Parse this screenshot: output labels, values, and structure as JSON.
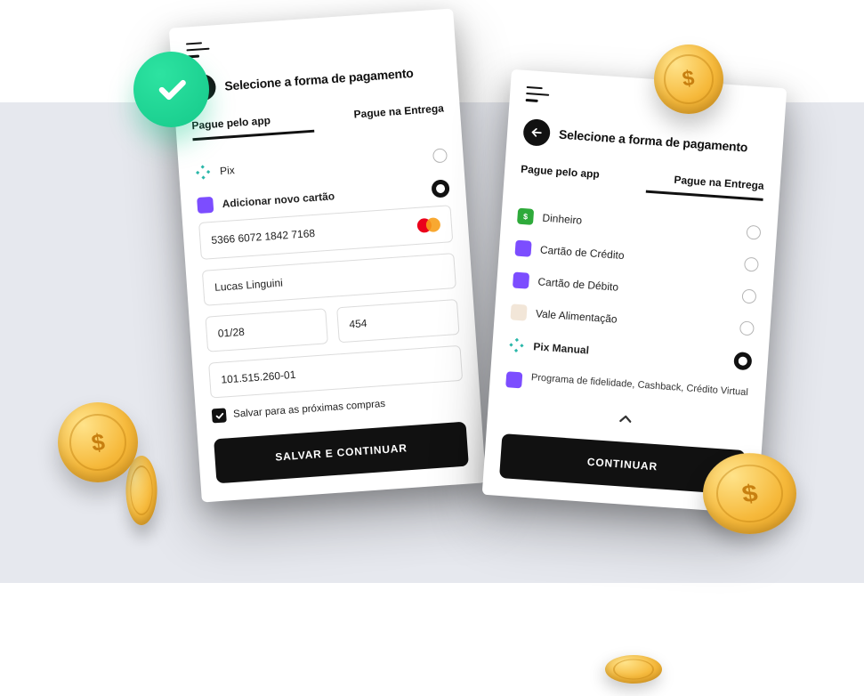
{
  "left": {
    "title": "Selecione a forma de pagamento",
    "tab_app": "Pague pelo app",
    "tab_delivery": "Pague na Entrega",
    "active_tab": "app",
    "options": {
      "pix": {
        "label": "Pix",
        "selected": false
      },
      "new_card": {
        "label": "Adicionar novo cartão",
        "selected": true
      }
    },
    "card_form": {
      "number": "5366 6072 1842 7168",
      "brand": "mastercard",
      "name": "Lucas Linguini",
      "expiry": "01/28",
      "cvv": "454",
      "cpf": "101.515.260-01",
      "save_checked": true,
      "save_label": "Salvar para as próximas compras"
    },
    "submit_label": "SALVAR E CONTINUAR"
  },
  "right": {
    "title": "Selecione a forma de pagamento",
    "tab_app": "Pague pelo app",
    "tab_delivery": "Pague na Entrega",
    "active_tab": "delivery",
    "options": [
      {
        "key": "cash",
        "label": "Dinheiro",
        "selected": false
      },
      {
        "key": "credit",
        "label": "Cartão de Crédito",
        "selected": false
      },
      {
        "key": "debit",
        "label": "Cartão de Débito",
        "selected": false
      },
      {
        "key": "meal",
        "label": "Vale Alimentação",
        "selected": false
      },
      {
        "key": "pix_manual",
        "label": "Pix Manual",
        "selected": true,
        "bold": true
      },
      {
        "key": "loyalty",
        "label": "Programa de fidelidade, Cashback, Crédito Virtual",
        "selected": false
      }
    ],
    "submit_label": "CONTINUAR"
  },
  "colors": {
    "accent": "#111111",
    "success": "#1fd495",
    "coin": "#f6b93b"
  }
}
